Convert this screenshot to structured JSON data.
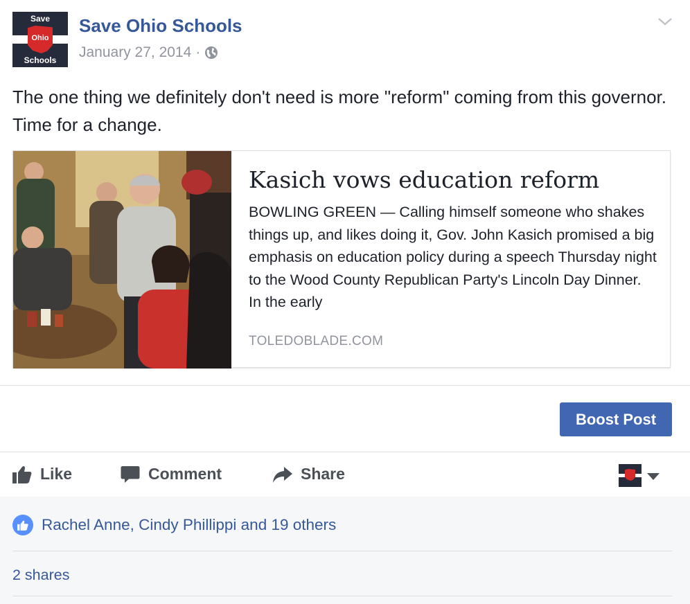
{
  "post": {
    "page_name": "Save Ohio Schools",
    "date": "January 27, 2014",
    "separator": "·",
    "privacy_icon": "globe-icon",
    "avatar": {
      "top": "Save",
      "middle": "Ohio",
      "bottom": "Schools"
    },
    "message": "The one thing we definitely don't need is more \"reform\" coming from this governor. Time for a change."
  },
  "link_card": {
    "title": "Kasich vows education reform",
    "description": "BOWLING GREEN — Calling himself someone who shakes things up, and likes doing it, Gov. John Kasich promised a big emphasis on education policy during a speech Thursday night to the Wood County Republican Party's Lincoln Day Dinner. In the early",
    "domain": "TOLEDOBLADE.COM"
  },
  "boost": {
    "label": "Boost Post"
  },
  "actions": {
    "like": "Like",
    "comment": "Comment",
    "share": "Share",
    "like_icon": "thumbs-up-icon",
    "comment_icon": "speech-bubble-icon",
    "share_icon": "share-arrow-icon"
  },
  "reactions": {
    "text": "Rachel Anne, Cindy Phillippi and 19 others",
    "shares": "2 shares"
  },
  "colors": {
    "brand_blue": "#365899",
    "button_blue": "#4267b2",
    "like_badge": "#5890ff",
    "ohio_red": "#d62a2a"
  }
}
